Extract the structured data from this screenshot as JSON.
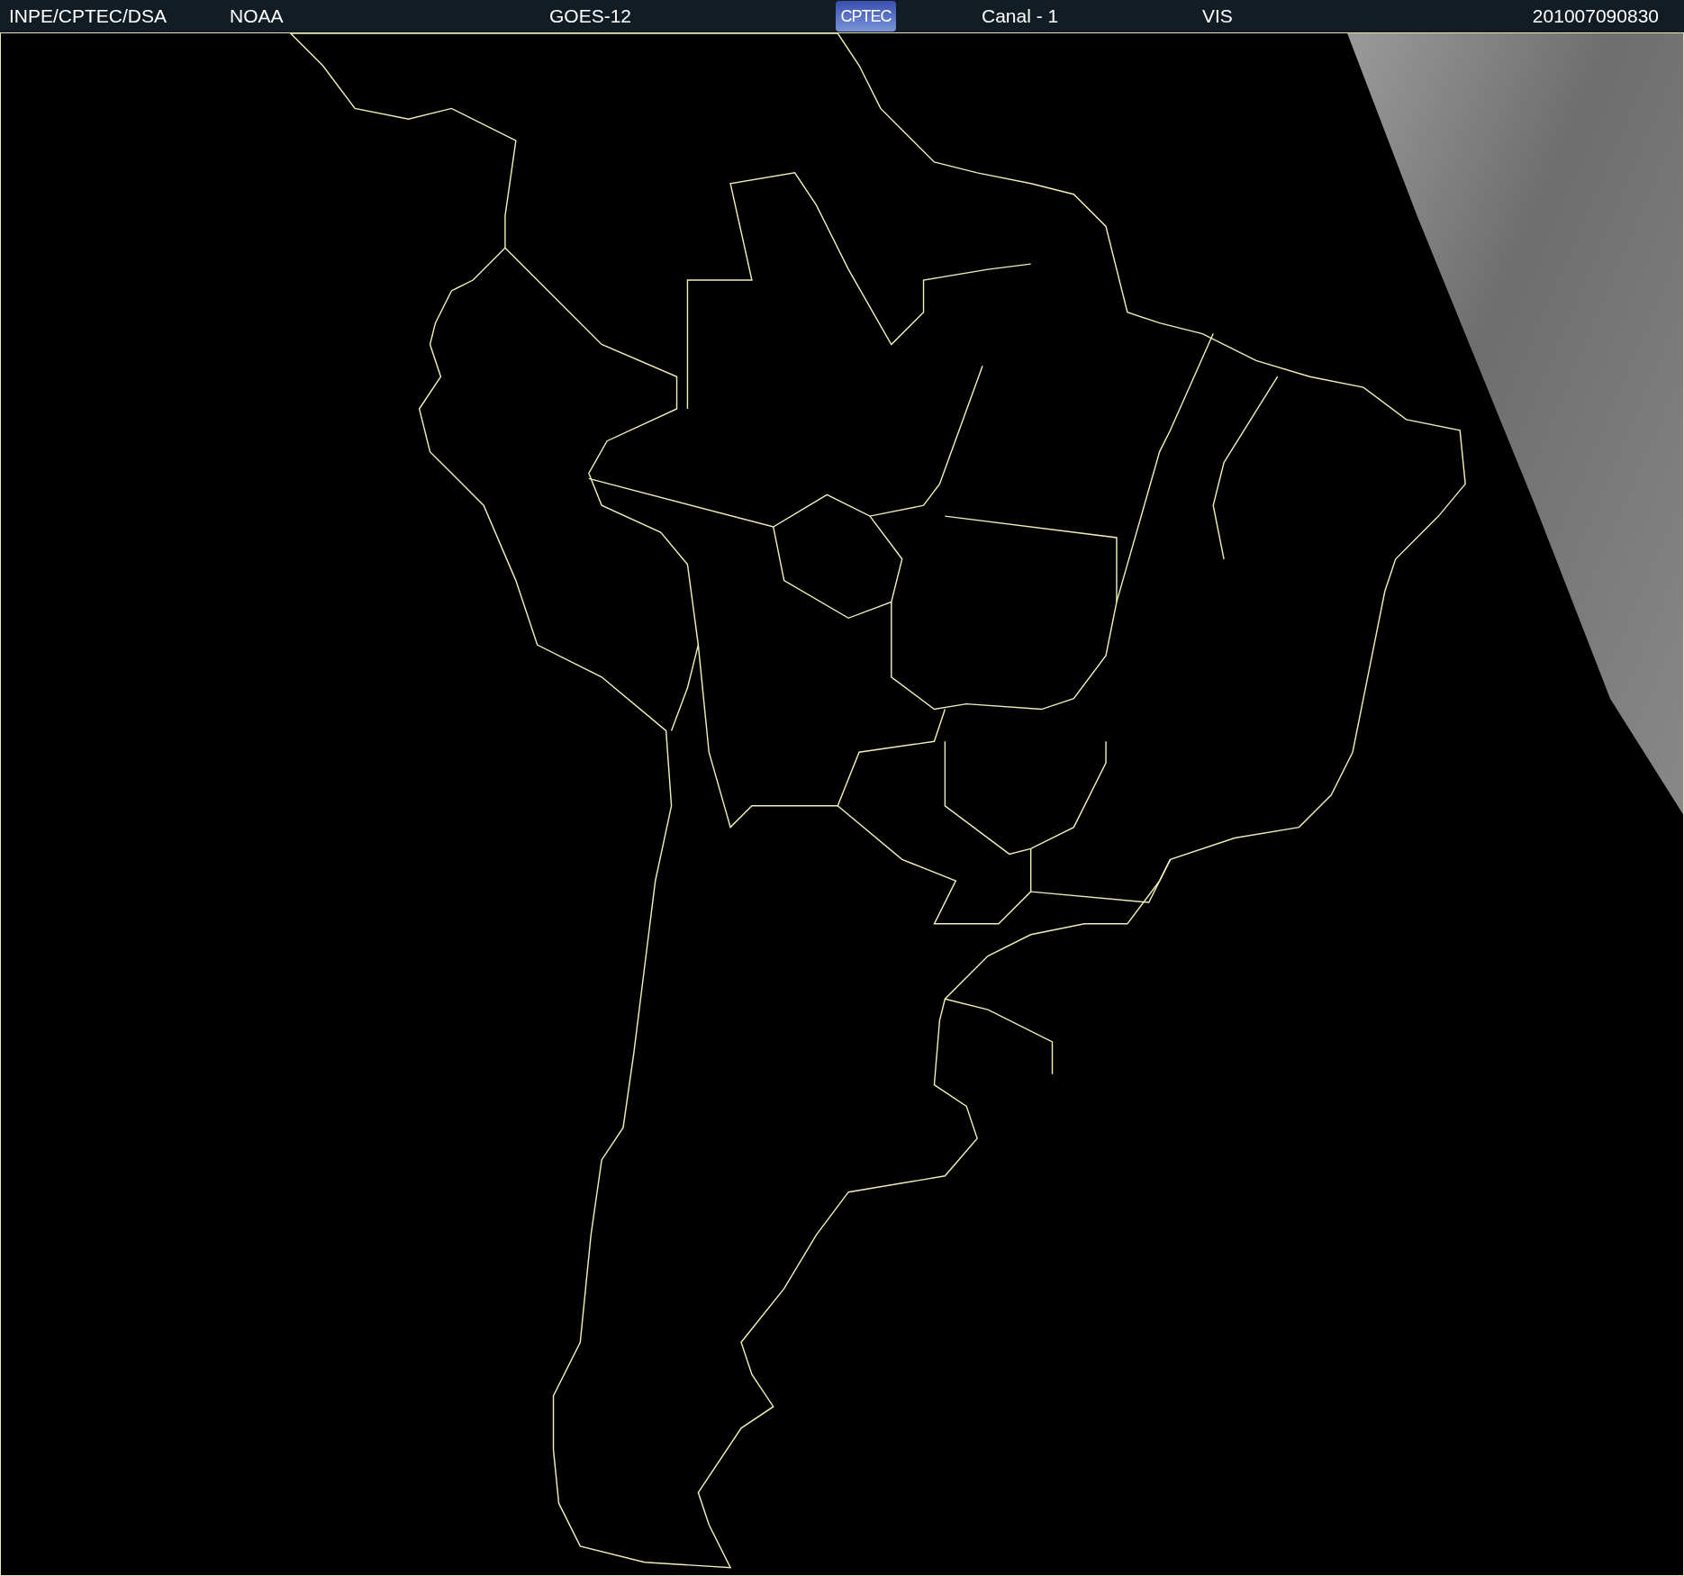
{
  "header": {
    "items": [
      {
        "kind": "text",
        "text": "INPE/CPTEC/DSA"
      },
      {
        "kind": "text",
        "text": "NOAA"
      },
      {
        "kind": "text",
        "text": "GOES-12"
      },
      {
        "kind": "logo",
        "text": "CPTEC"
      },
      {
        "kind": "text",
        "text": "Canal - 1"
      },
      {
        "kind": "text",
        "text": "VIS"
      },
      {
        "kind": "text",
        "text": "201007090830"
      }
    ]
  }
}
